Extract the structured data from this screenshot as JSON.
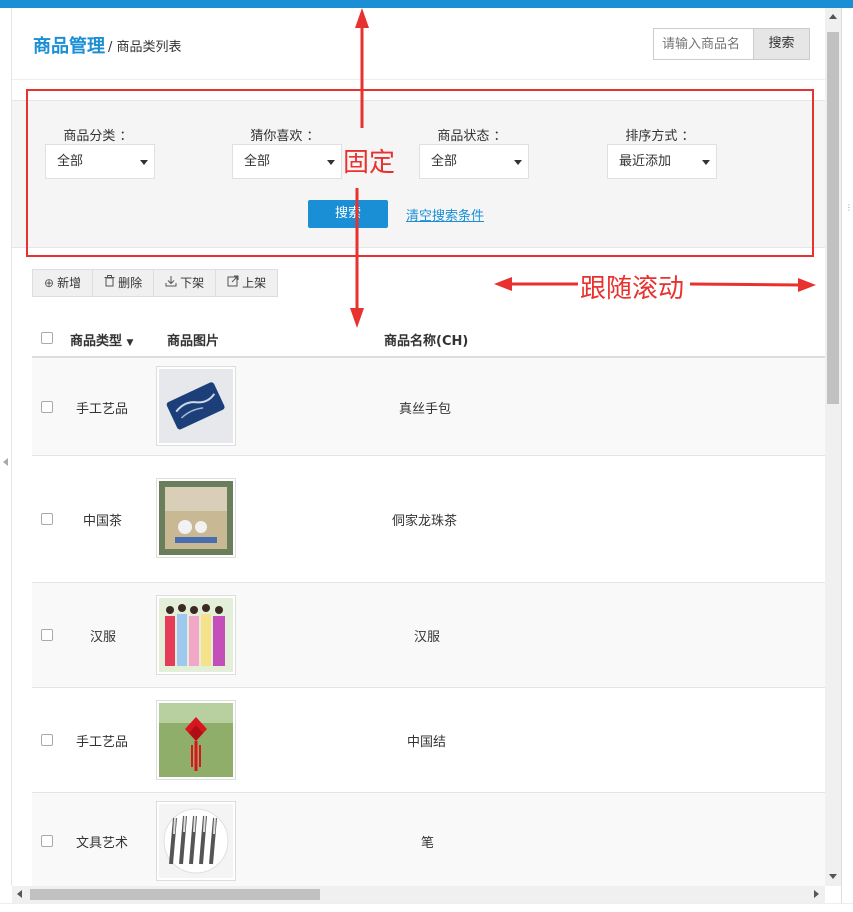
{
  "header": {
    "title": "商品管理",
    "breadcrumb": "/ 商品类列表",
    "search_placeholder": "请输入商品名",
    "search_button": "搜索"
  },
  "filters": [
    {
      "label": "商品分类 ：",
      "value": "全部"
    },
    {
      "label": "猜你喜欢 ：",
      "value": "全部"
    },
    {
      "label": "商品状态 ：",
      "value": "全部"
    },
    {
      "label": "排序方式 ：",
      "value": "最近添加"
    }
  ],
  "filter_actions": {
    "search": "搜索",
    "clear": "清空搜索条件"
  },
  "toolbar": [
    {
      "icon": "add-circle-icon",
      "glyph": "⊕",
      "label": "新增"
    },
    {
      "icon": "trash-icon",
      "glyph": "🗑",
      "label": "删除"
    },
    {
      "icon": "download-icon",
      "glyph": "⤓",
      "label": "下架"
    },
    {
      "icon": "external-link-icon",
      "glyph": "↗",
      "label": "上架"
    }
  ],
  "table": {
    "headers": {
      "type": "商品类型",
      "image": "商品图片",
      "name": "商品名称(CH)"
    },
    "rows": [
      {
        "type": "手工艺品",
        "name": "真丝手包",
        "image": "blue-silk-wallet"
      },
      {
        "type": "中国茶",
        "name": "侗家龙珠茶",
        "image": "tea-gift-box"
      },
      {
        "type": "汉服",
        "name": "汉服",
        "image": "hanfu-models"
      },
      {
        "type": "手工艺品",
        "name": "中国结",
        "image": "chinese-knot"
      },
      {
        "type": "文具艺术",
        "name": "笔",
        "image": "pens-set"
      }
    ]
  },
  "annotations": {
    "fixed": "固定",
    "follow_scroll": "跟随滚动"
  },
  "colors": {
    "accent": "#1a8fd6",
    "annotation": "#e8322f"
  }
}
